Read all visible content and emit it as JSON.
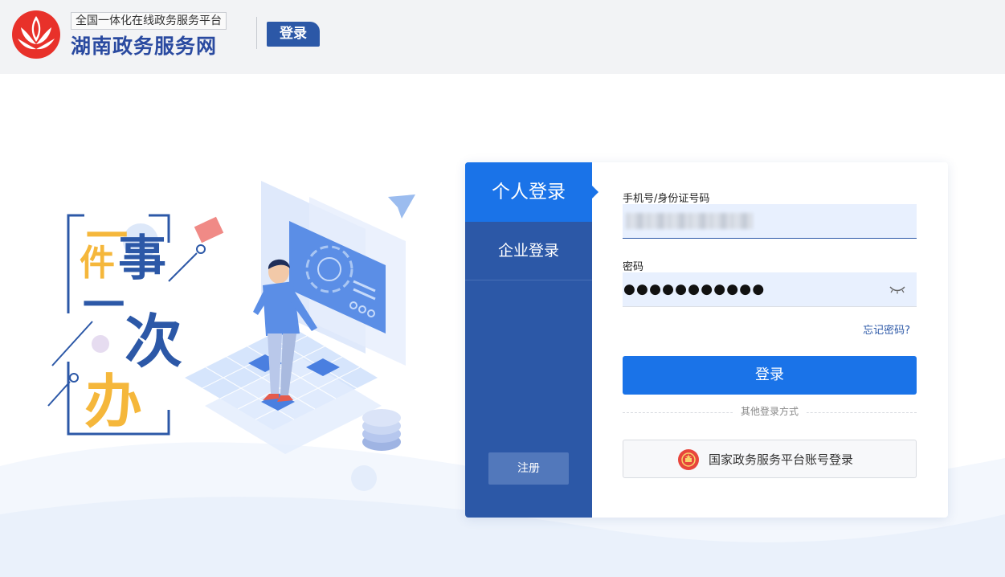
{
  "header": {
    "platform_name": "全国一体化在线政务服务平台",
    "site_title": "湖南政务服务网",
    "page_tag": "登录"
  },
  "illustration": {
    "slogan_chars": [
      "一",
      "件",
      "事",
      "一",
      "次",
      "办"
    ]
  },
  "login_panel": {
    "tabs": [
      {
        "label": "个人登录",
        "active": true
      },
      {
        "label": "企业登录",
        "active": false
      }
    ],
    "register_label": "注册",
    "account_label": "手机号/身份证号码",
    "password_label": "密码",
    "password_masked": "●●●●●●●●●●●",
    "forgot_password": "忘记密码?",
    "login_button": "登录",
    "other_methods": "其他登录方式",
    "national_login": "国家政务服务平台账号登录"
  },
  "icons": [
    "lotus-logo-icon",
    "eye-closed-icon",
    "national-emblem-icon",
    "paper-plane-icon"
  ],
  "colors": {
    "primary": "#1a73e8",
    "sidebar": "#2c58a7",
    "brand_title": "#2a4aa0",
    "slogan_gold": "#f5b73b",
    "input_bg": "#e8f0fe"
  }
}
